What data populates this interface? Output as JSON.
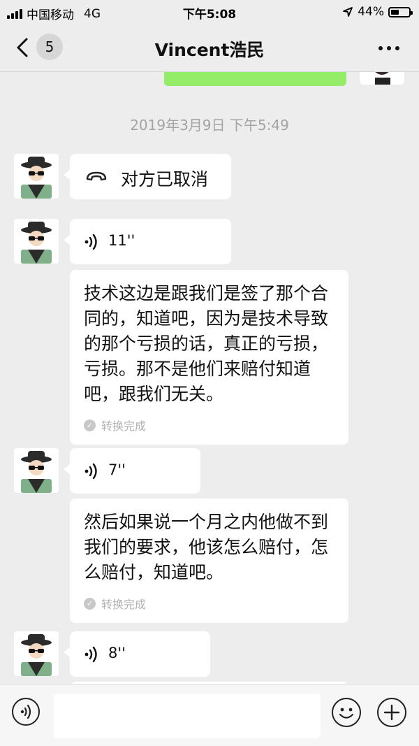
{
  "status_bar": {
    "carrier": "中国移动",
    "network": "4G",
    "time": "下午5:08",
    "battery": "44%",
    "battery_level": 0.44
  },
  "nav": {
    "unread_count": "5",
    "title": "Vincent浩民"
  },
  "chat": {
    "timestamp": "2019年3月9日 下午5:49",
    "call_status": "对方已取消",
    "voice_messages": [
      {
        "duration": "11''",
        "transcript": "技术这边是跟我们是签了那个合同的，知道吧，因为是技术导致的那个亏损的话，真正的亏损，亏损。那不是他们来赔付知道吧，跟我们无关。",
        "status": "转换完成"
      },
      {
        "duration": "7''",
        "transcript": "然后如果说一个月之内他做不到我们的要求，他该怎么赔付，怎么赔付，知道吧。",
        "status": "转换完成"
      },
      {
        "duration": "8''"
      }
    ]
  },
  "colors": {
    "background": "#ededed",
    "own_bubble": "#95ec69",
    "bubble": "#ffffff",
    "timestamp_text": "#a4a4a4",
    "status_text": "#b2b2b2"
  },
  "icons": {
    "back": "chevron-left-icon",
    "more": "ellipsis-icon",
    "call": "phone-hangup-icon",
    "voice": "voice-wave-icon",
    "converted": "check-circle-icon",
    "voice_toggle": "voice-input-icon",
    "emoji": "emoji-icon",
    "add": "plus-circle-icon"
  }
}
